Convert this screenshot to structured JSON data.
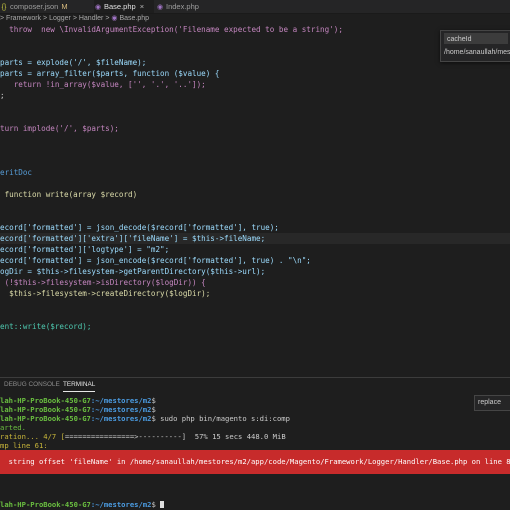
{
  "tabs": [
    {
      "icon": "{}",
      "label": "composer.json",
      "modified": "M",
      "active": false
    },
    {
      "icon": "php",
      "label": "Base.php",
      "close": "×",
      "active": true
    },
    {
      "icon": "php",
      "label": "Index.php",
      "active": false
    }
  ],
  "breadcrumb": {
    "parts": [
      "Framework",
      "Logger",
      "Handler"
    ],
    "file": "Base.php",
    "separator": ">"
  },
  "code_lines": [
    {
      "text": "  throw  new \\InvalidArgumentException('Filename expected to be a string');",
      "strikethrough": false
    },
    {
      "text": ""
    },
    {
      "text": ""
    },
    {
      "text": "parts = explode('/', $fileName);"
    },
    {
      "text": "parts = array_filter($parts, function ($value) {"
    },
    {
      "text": "   return !in_array($value, ['', '.', '..']);"
    },
    {
      "text": ";"
    },
    {
      "text": ""
    },
    {
      "text": ""
    },
    {
      "text": "turn implode('/', $parts);"
    },
    {
      "text": ""
    },
    {
      "text": ""
    },
    {
      "text": ""
    },
    {
      "text": "eritDoc"
    },
    {
      "text": ""
    },
    {
      "text": " function write(array $record)"
    },
    {
      "text": ""
    },
    {
      "text": ""
    },
    {
      "text": "ecord['formatted'] = json_decode($record['formatted'], true);"
    },
    {
      "text": "ecord['formatted']['extra']['fileName'] = $this->fileName;"
    },
    {
      "text": "ecord['formatted']['logtype'] = \"m2\";"
    },
    {
      "text": "ecord['formatted'] = json_encode($record['formatted'], true) . \"\\n\";"
    },
    {
      "text": "ogDir = $this->filesystem->getParentDirectory($this->url);"
    },
    {
      "text": " (!$this->filesystem->isDirectory($logDir)) {"
    },
    {
      "text": "  $this->filesystem->createDirectory($logDir);"
    },
    {
      "text": ""
    },
    {
      "text": ""
    },
    {
      "text": "ent::write($record);"
    }
  ],
  "find_widget": {
    "input_value": "cacheId",
    "result_path": "/home/sanaullah/mestores"
  },
  "panel_tabs": [
    {
      "label": "DEBUG CONSOLE",
      "active": false
    },
    {
      "label": "TERMINAL",
      "active": true
    }
  ],
  "replace_widget": {
    "value": "replace"
  },
  "terminal": {
    "prompt_user": "lah-HP-ProBook-450-G7",
    "prompt_path": ":~/mestores/m2",
    "prompt_suffix": "$",
    "command": " sudo php bin/magento s:di:comp",
    "started": "arted.",
    "progress_prefix": "ration... 4/7 [",
    "progress_bar": "================>",
    "progress_rest": "----------]",
    "progress_pct": "57%",
    "progress_time": "15 secs",
    "progress_mem": "448.0 MiB",
    "line_text": "mp line 61:",
    "error": "  string offset 'fileName' in /home/sanaullah/mestores/m2/app/code/Magento/Framework/Logger/Handler/Base.php on line 87"
  },
  "colors": {
    "editor_bg": "#1e1e1e",
    "error_bg": "#c72b2b",
    "prompt_green": "#6abf40",
    "path_blue": "#4b9be0"
  }
}
